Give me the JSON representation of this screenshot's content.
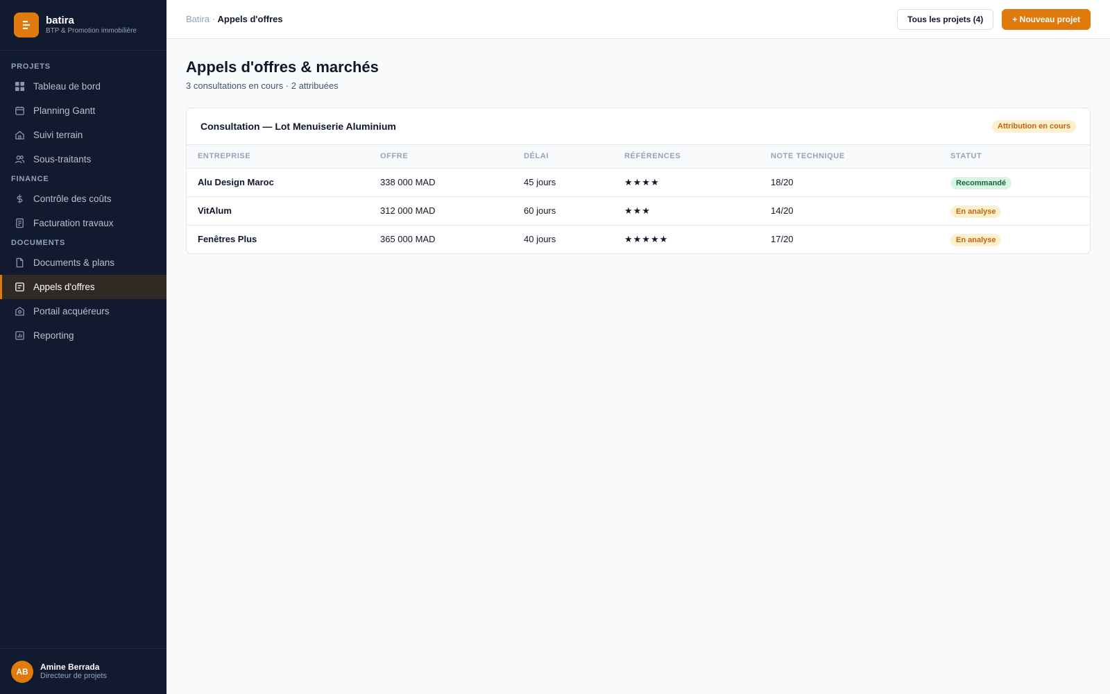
{
  "brand": {
    "name": "batira",
    "subtitle": "BTP & Promotion immobilière",
    "accent": "#e07a0c"
  },
  "sidebar": {
    "sections": [
      {
        "title": "PROJETS",
        "items": [
          {
            "label": "Tableau de bord",
            "icon": "grid-icon"
          },
          {
            "label": "Planning Gantt",
            "icon": "calendar-icon"
          },
          {
            "label": "Suivi terrain",
            "icon": "home-icon"
          },
          {
            "label": "Sous-traitants",
            "icon": "users-icon"
          }
        ]
      },
      {
        "title": "FINANCE",
        "items": [
          {
            "label": "Contrôle des coûts",
            "icon": "dollar-icon"
          },
          {
            "label": "Facturation travaux",
            "icon": "invoice-icon"
          }
        ]
      },
      {
        "title": "DOCUMENTS",
        "items": [
          {
            "label": "Documents & plans",
            "icon": "file-icon"
          },
          {
            "label": "Appels d'offres",
            "icon": "tender-icon",
            "active": true
          },
          {
            "label": "Portail acquéreurs",
            "icon": "portal-icon"
          },
          {
            "label": "Reporting",
            "icon": "chart-icon"
          }
        ]
      }
    ]
  },
  "user": {
    "initials": "AB",
    "name": "Amine Berrada",
    "role": "Directeur de projets"
  },
  "topbar": {
    "breadcrumb_root": "Batira",
    "breadcrumb_sep": " · ",
    "breadcrumb_current": "Appels d'offres",
    "all_projects_label": "Tous les projets (4)",
    "new_project_label": "+ Nouveau projet"
  },
  "page": {
    "title": "Appels d'offres & marchés",
    "subtitle": "3 consultations en cours · 2 attribuées"
  },
  "consultation": {
    "title": "Consultation — Lot Menuiserie Aluminium",
    "status": "Attribution en cours",
    "columns": [
      "ENTREPRISE",
      "OFFRE",
      "DÉLAI",
      "RÉFÉRENCES",
      "NOTE TECHNIQUE",
      "STATUT"
    ],
    "rows": [
      {
        "company": "Alu Design Maroc",
        "offer": "338 000 MAD",
        "delay": "45 jours",
        "references": "★★★★",
        "note": "18/20",
        "status": "Recommandé",
        "status_type": "green"
      },
      {
        "company": "VitAlum",
        "offer": "312 000 MAD",
        "delay": "60 jours",
        "references": "★★★",
        "note": "14/20",
        "status": "En analyse",
        "status_type": "amber"
      },
      {
        "company": "Fenêtres Plus",
        "offer": "365 000 MAD",
        "delay": "40 jours",
        "references": "★★★★★",
        "note": "17/20",
        "status": "En analyse",
        "status_type": "amber"
      }
    ]
  }
}
